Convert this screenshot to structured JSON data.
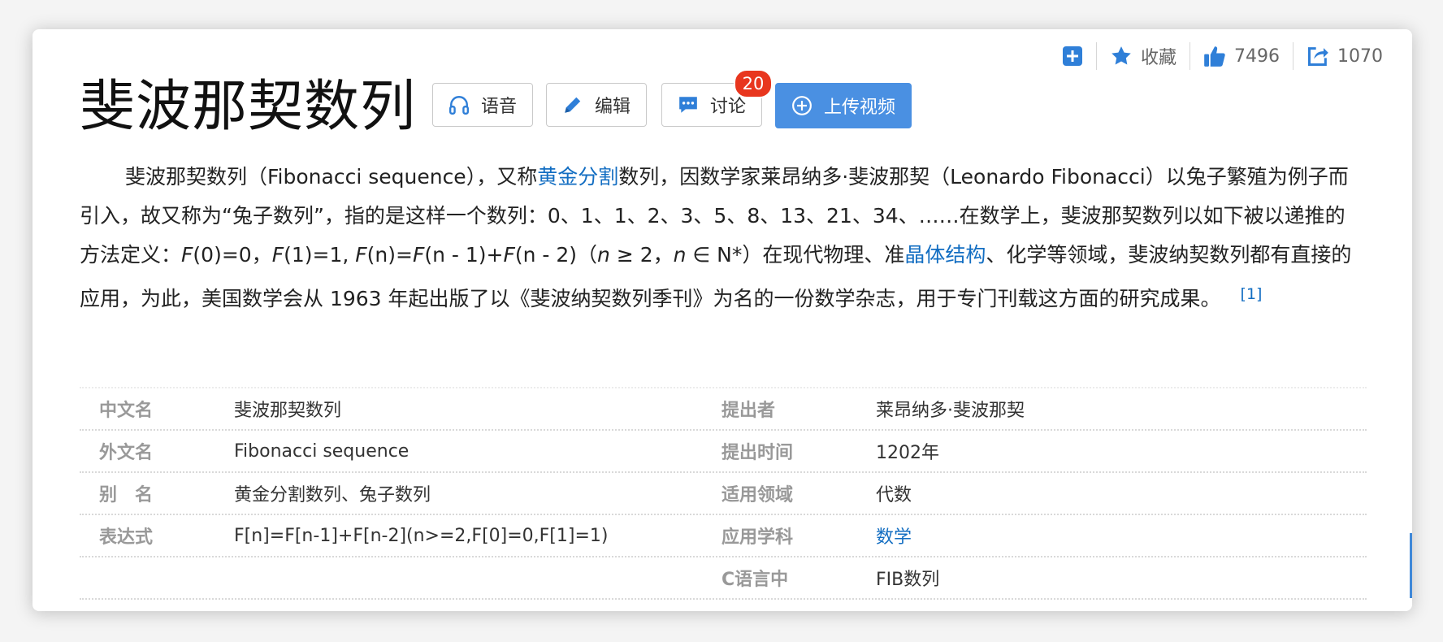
{
  "toolbar": {
    "collect_label": "收藏",
    "like_count": "7496",
    "share_count": "1070"
  },
  "title": "斐波那契数列",
  "buttons": {
    "voice": "语音",
    "edit": "编辑",
    "discuss": "讨论",
    "discuss_badge": "20",
    "upload": "上传视频"
  },
  "summary": {
    "p1": "斐波那契数列（Fibonacci sequence），又称",
    "link1": "黄金分割",
    "p2": "数列，因数学家莱昂纳多·斐波那契（Leonardo Fibonacci）以兔子繁殖为例子而引入，故又称为“兔子数列”，指的是这样一个数列：0、1、1、2、3、5、8、13、21、34、……在数学上，斐波那契数列以如下被以递推的方法定义：",
    "f1": "F",
    "f1v": "(0)=0，",
    "f2": "F",
    "f2v": "(1)=1, ",
    "f3": "F",
    "f3v": "(n)=",
    "f4": "F",
    "f4v": "(n - 1)+",
    "f5": "F",
    "f5v": "(n - 2)（",
    "n1": "n",
    "cond1": " ≥ 2，",
    "n2": "n",
    "cond2": " ∈ N*）在现代物理、准",
    "link2": "晶体结构",
    "p3": "、化学等领域，斐波纳契数列都有直接的应用，为此，美国数学会从 1963 年起出版了以《斐波纳契数列季刊》为名的一份数学杂志，用于专门刊载这方面的研究成果。",
    "ref": "[1]"
  },
  "info": [
    {
      "k1": "中文名",
      "v1": "斐波那契数列",
      "k2": "提出者",
      "v2": "莱昂纳多·斐波那契"
    },
    {
      "k1": "外文名",
      "v1": "Fibonacci sequence",
      "k2": "提出时间",
      "v2": "1202年"
    },
    {
      "k1": "别　名",
      "v1": "黄金分割数列、兔子数列",
      "k2": "适用领域",
      "v2": "代数"
    },
    {
      "k1": "表达式",
      "v1": "F[n]=F[n-1]+F[n-2](n>=2,F[0]=0,F[1]=1)",
      "k2": "应用学科",
      "v2": "数学"
    },
    {
      "k1": "",
      "v1": "",
      "k2": "C语言中",
      "v2": "FIB数列"
    }
  ],
  "colors": {
    "link": "#136ec2",
    "accent_button": "#4a90e2",
    "badge": "#e8361e",
    "toolbar_icon": "#2f7fd8"
  },
  "icons": [
    "add-box-icon",
    "star-icon",
    "thumbs-up-icon",
    "share-icon",
    "headphones-icon",
    "pencil-icon",
    "chat-icon",
    "plus-circle-icon"
  ]
}
